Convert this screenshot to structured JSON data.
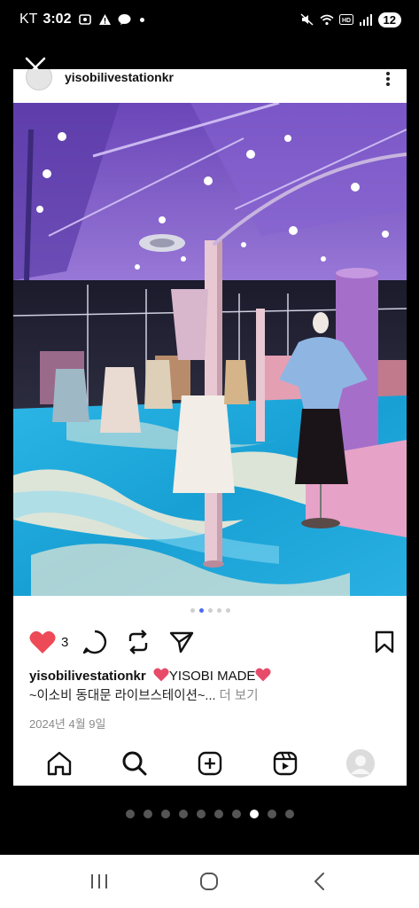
{
  "status_bar": {
    "carrier": "KT",
    "time": "3:02",
    "battery": "12"
  },
  "post": {
    "username": "yisobilivestationkr",
    "like_count": "3",
    "caption_title": "YISOBI MADE",
    "caption_line2": "~이소비 동대문 라이브스테이션~...",
    "more_label": "더 보기",
    "date": "2024년 4월 9일",
    "image_dots_total": 5,
    "image_dots_active": 1
  },
  "gallery": {
    "dots_total": 10,
    "active_index": 7
  },
  "colors": {
    "heart": "#ed4956",
    "dot_active": "#4a6cf0",
    "floor_blue": "#1aa6d6",
    "ceiling_purple": "#7b58c9"
  },
  "icons": {
    "close": "close-icon",
    "more": "more-icon",
    "like": "heart-filled-icon",
    "comment": "comment-icon",
    "repost": "repost-icon",
    "share": "send-icon",
    "save": "bookmark-icon",
    "home": "home-icon",
    "search": "search-icon",
    "create": "create-icon",
    "reels": "reels-icon",
    "profile": "profile-avatar",
    "sys_recents": "recents-icon",
    "sys_home": "home-circle-icon",
    "sys_back": "back-icon"
  }
}
